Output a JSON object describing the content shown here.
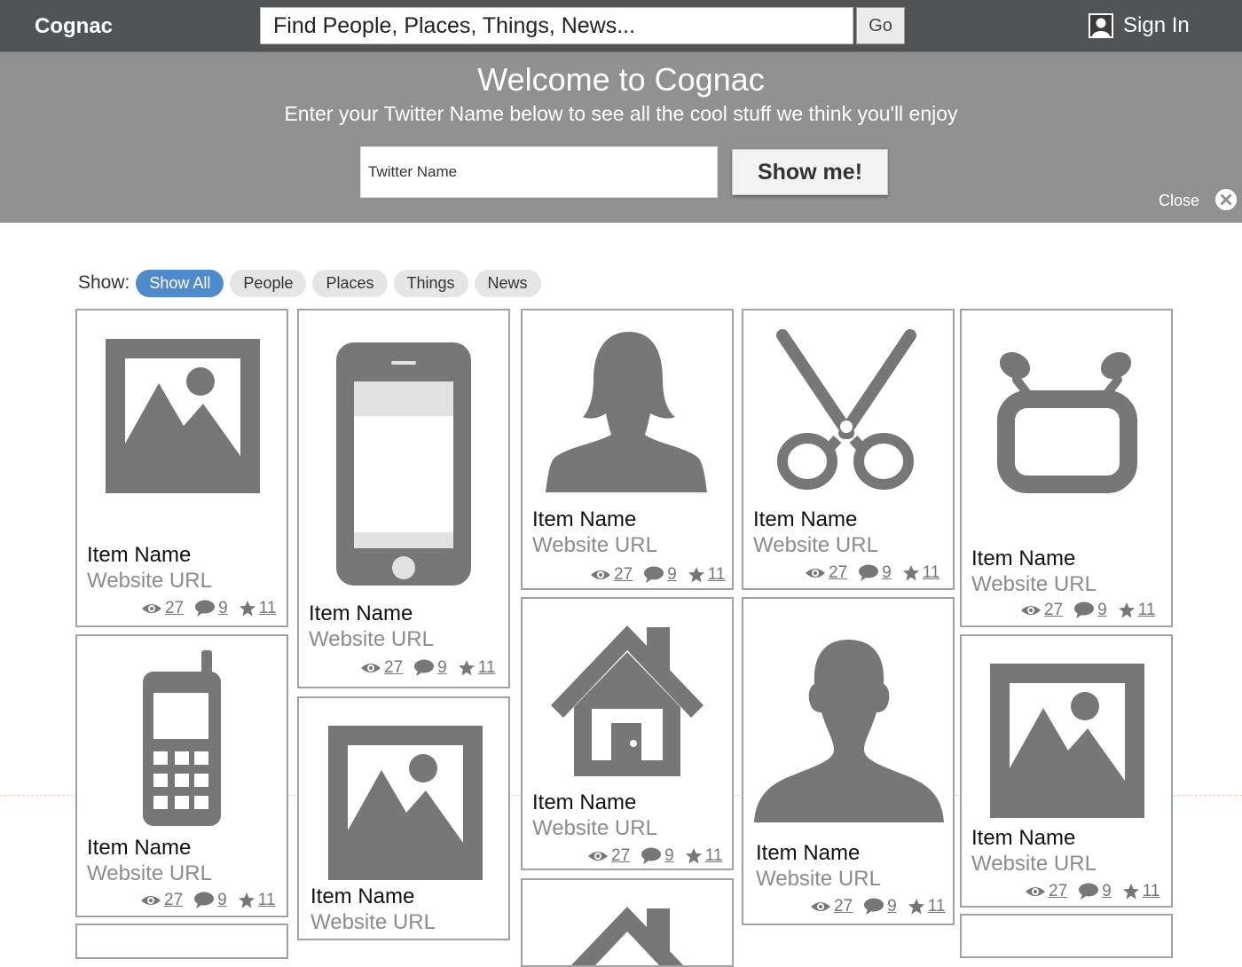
{
  "header": {
    "brand": "Cognac",
    "search_placeholder": "Find People, Places, Things, News...",
    "go_label": "Go",
    "signin_label": "Sign In"
  },
  "banner": {
    "title": "Welcome to Cognac",
    "subtitle": "Enter your Twitter Name below to see all the cool stuff we think you'll enjoy",
    "twitter_placeholder": "Twitter Name",
    "show_button": "Show me!",
    "close_label": "Close"
  },
  "filters": {
    "label": "Show:",
    "options": [
      "Show All",
      "People",
      "Places",
      "Things",
      "News"
    ],
    "active": "Show All"
  },
  "items": [
    {
      "icon": "image-icon",
      "name": "Item Name",
      "url": "Website URL",
      "views": "27",
      "comments": "9",
      "stars": "11"
    },
    {
      "icon": "smartphone-icon",
      "name": "Item Name",
      "url": "Website URL",
      "views": "27",
      "comments": "9",
      "stars": "11"
    },
    {
      "icon": "woman-silhouette-icon",
      "name": "Item Name",
      "url": "Website URL",
      "views": "27",
      "comments": "9",
      "stars": "11"
    },
    {
      "icon": "scissors-icon",
      "name": "Item Name",
      "url": "Website URL",
      "views": "27",
      "comments": "9",
      "stars": "11"
    },
    {
      "icon": "tv-icon",
      "name": "Item Name",
      "url": "Website URL",
      "views": "27",
      "comments": "9",
      "stars": "11"
    },
    {
      "icon": "cellphone-icon",
      "name": "Item Name",
      "url": "Website URL",
      "views": "27",
      "comments": "9",
      "stars": "11"
    },
    {
      "icon": "image-icon",
      "name": "Item Name",
      "url": "Website URL"
    },
    {
      "icon": "house-icon",
      "name": "Item Name",
      "url": "Website URL",
      "views": "27",
      "comments": "9",
      "stars": "11"
    },
    {
      "icon": "man-silhouette-icon",
      "name": "Item Name",
      "url": "Website URL",
      "views": "27",
      "comments": "9",
      "stars": "11"
    },
    {
      "icon": "image-icon",
      "name": "Item Name",
      "url": "Website URL",
      "views": "27",
      "comments": "9",
      "stars": "11"
    },
    {
      "icon": "house-icon"
    }
  ],
  "colors": {
    "accent": "#4f8acb",
    "header": "#515354",
    "banner": "#919191",
    "icon": "#767776"
  }
}
